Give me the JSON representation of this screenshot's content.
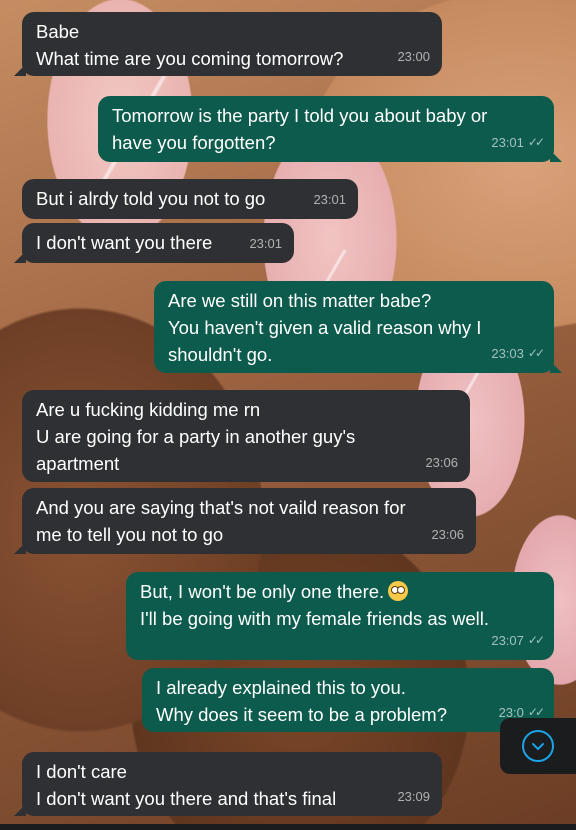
{
  "messages": [
    {
      "direction": "incoming",
      "lines": [
        "Babe",
        "What time are you coming tomorrow?"
      ],
      "time": "23:00"
    },
    {
      "direction": "outgoing",
      "lines": [
        "Tomorrow is the party I told you about baby or",
        "have you forgotten?"
      ],
      "time": "23:01",
      "status": "read"
    },
    {
      "direction": "incoming",
      "lines": [
        "But i alrdy told you not to go"
      ],
      "time": "23:01"
    },
    {
      "direction": "incoming",
      "lines": [
        "I don't want you there"
      ],
      "time": "23:01"
    },
    {
      "direction": "outgoing",
      "lines": [
        "Are we still on this matter babe?",
        "You haven't given a valid reason why I",
        "shouldn't go."
      ],
      "time": "23:03",
      "status": "read"
    },
    {
      "direction": "incoming",
      "lines": [
        "Are u fucking kidding me rn",
        "U are going for a party in another guy's",
        "apartment"
      ],
      "time": "23:06"
    },
    {
      "direction": "incoming",
      "lines": [
        "And you are saying that's not vaild reason for",
        "me to tell you not to go"
      ],
      "time": "23:06"
    },
    {
      "direction": "outgoing",
      "lines": [
        "But, I won't be only one there.",
        "I'll be going with my female friends as well."
      ],
      "time": "23:07",
      "status": "read",
      "emoji": "rolling-eyes-emoji"
    },
    {
      "direction": "outgoing",
      "lines": [
        "I already explained this to you.",
        "Why does it seem to be a problem?"
      ],
      "time": "23:0",
      "status": "read"
    },
    {
      "direction": "incoming",
      "lines": [
        "I don't care",
        "I don't want you there and that's final"
      ],
      "time": "23:09"
    }
  ],
  "ticks_glyph": "✓✓",
  "scroll_button_icon": "chevron-down-icon",
  "colors": {
    "incoming_bubble": "#2f3033",
    "outgoing_bubble": "#0c5b4c",
    "accent": "#1aa3e8"
  }
}
